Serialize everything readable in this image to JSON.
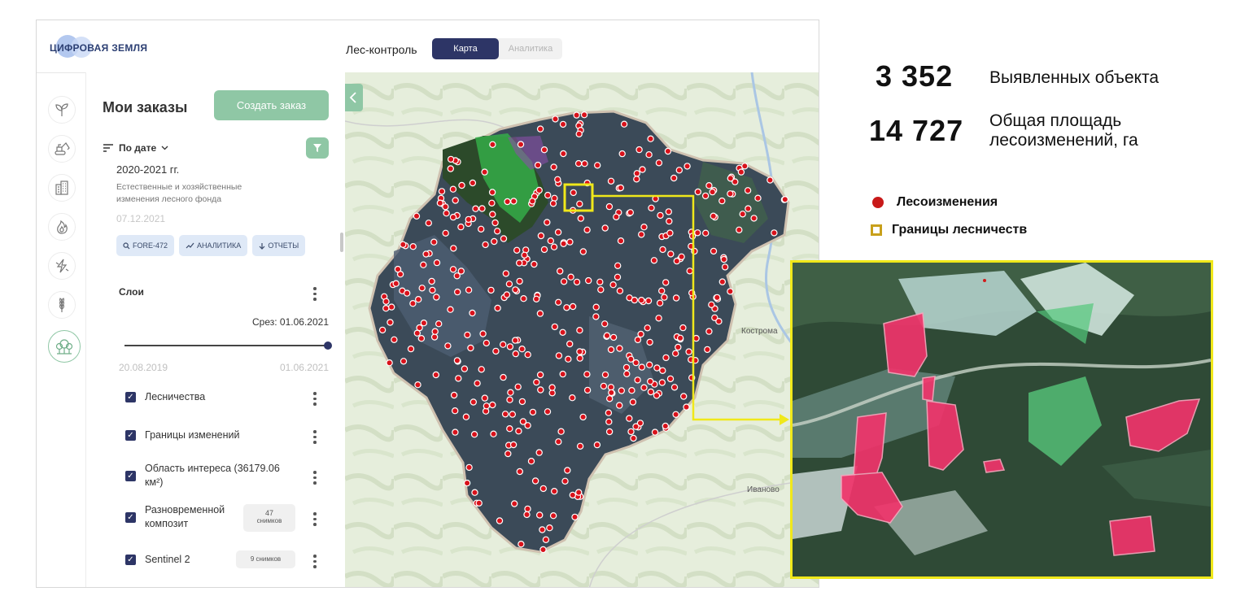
{
  "header": {
    "logo_text": "ЦИФРОВАЯ ЗЕМЛЯ",
    "app_name": "Лес-контроль",
    "tabs": [
      {
        "label": "Карта",
        "active": true
      },
      {
        "label": "Аналитика",
        "active": false
      }
    ]
  },
  "rail": {
    "icons": [
      "plant-icon",
      "excavator-icon",
      "building-icon",
      "fire-icon",
      "lightning-icon",
      "wheat-icon",
      "forest-icon"
    ],
    "selected": "forest-icon"
  },
  "panel": {
    "title": "Мои заказы",
    "create_button": "Создать заказ",
    "sort_label": "По дате",
    "order": {
      "period": "2020-2021 гг.",
      "description": "Естественные и хозяйственные изменения лесного фонда",
      "date": "07.12.2021",
      "chips": [
        "FORE-472",
        "АНАЛИТИКА",
        "ОТЧЕТЫ"
      ]
    },
    "layers_title": "Слои",
    "slice_label": "Срез: 01.06.2021",
    "range_start": "20.08.2019",
    "range_end": "01.06.2021",
    "slider_position": 1.0,
    "layers": [
      {
        "label": "Лесничества",
        "checked": true,
        "badge": ""
      },
      {
        "label": "Границы изменений",
        "checked": true,
        "badge": ""
      },
      {
        "label": "Область интереса (36179.06 км²)",
        "checked": true,
        "badge": ""
      },
      {
        "label": "Разновременной композит",
        "checked": true,
        "badge_count": "47",
        "badge_unit": "снимков"
      },
      {
        "label": "Sentinel 2",
        "checked": true,
        "badge": "9 снимков"
      }
    ]
  },
  "map": {
    "cities": [
      "Кострома",
      "Иваново"
    ]
  },
  "stats": {
    "detected_count": "3 352",
    "detected_label": "Выявленных объекта",
    "area_value": "14 727",
    "area_label_1": "Общая площадь",
    "area_label_2": "лесоизменений, га"
  },
  "legend": {
    "changes_label": "Лесоизменения",
    "borders_label": "Границы лесничеств",
    "changes_color": "#c81919",
    "borders_color": "#c8a01b"
  },
  "colors": {
    "accent": "#2d3566",
    "green": "#8fc7a5",
    "highlight": "#f0e81a"
  }
}
